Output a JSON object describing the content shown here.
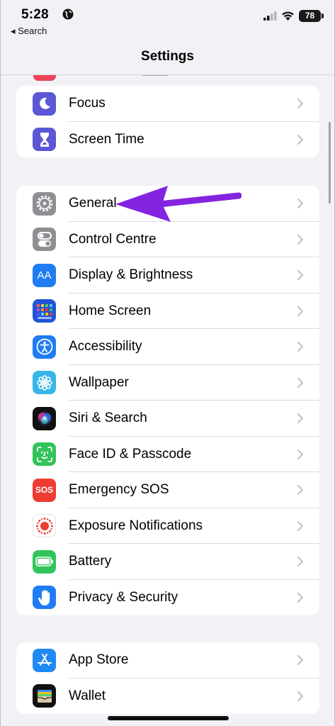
{
  "status_bar": {
    "time": "5:28",
    "back_label": "◂ Search",
    "battery": "78",
    "icons": [
      "globe-icon",
      "cellular-signal-icon",
      "wifi-icon",
      "battery-icon"
    ]
  },
  "nav": {
    "title": "Settings"
  },
  "colors": {
    "background": "#f2f1f6",
    "focus": "#5b57d6",
    "screen_time": "#5b57d6",
    "general": "#8e8e93",
    "blue": "#1f7cf3",
    "green": "#32c45a",
    "red": "#ee3b33",
    "arrow": "#8424e0"
  },
  "groups": [
    {
      "items": [
        {
          "label": "Focus",
          "icon": "moon-icon"
        },
        {
          "label": "Screen Time",
          "icon": "hourglass-icon"
        }
      ]
    },
    {
      "items": [
        {
          "label": "General",
          "icon": "gear-icon"
        },
        {
          "label": "Control Centre",
          "icon": "toggles-icon"
        },
        {
          "label": "Display & Brightness",
          "icon": "text-size-icon",
          "icon_text": "AA"
        },
        {
          "label": "Home Screen",
          "icon": "app-grid-icon"
        },
        {
          "label": "Accessibility",
          "icon": "accessibility-icon"
        },
        {
          "label": "Wallpaper",
          "icon": "flower-icon"
        },
        {
          "label": "Siri & Search",
          "icon": "siri-icon"
        },
        {
          "label": "Face ID & Passcode",
          "icon": "face-id-icon"
        },
        {
          "label": "Emergency SOS",
          "icon": "sos-icon",
          "icon_text": "SOS"
        },
        {
          "label": "Exposure Notifications",
          "icon": "exposure-icon"
        },
        {
          "label": "Battery",
          "icon": "battery-setting-icon"
        },
        {
          "label": "Privacy & Security",
          "icon": "hand-icon"
        }
      ]
    },
    {
      "items": [
        {
          "label": "App Store",
          "icon": "app-store-icon"
        },
        {
          "label": "Wallet",
          "icon": "wallet-icon"
        }
      ]
    }
  ]
}
